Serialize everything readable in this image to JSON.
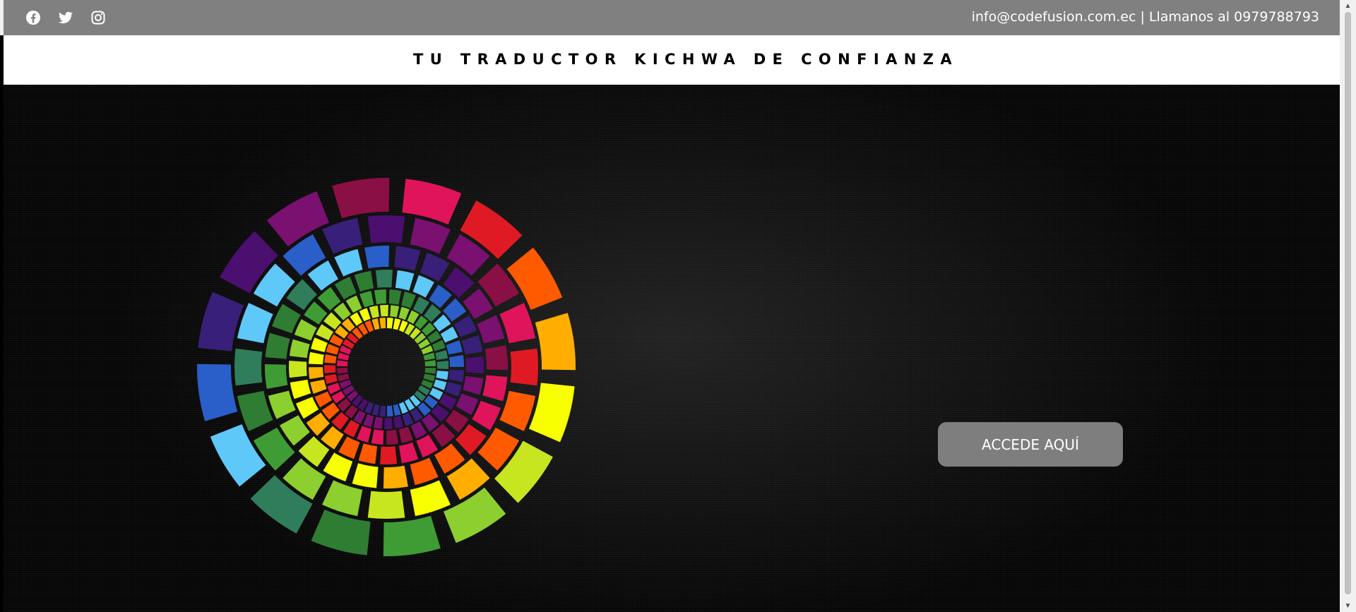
{
  "topbar": {
    "social": [
      "facebook-icon",
      "twitter-icon",
      "instagram-icon"
    ],
    "contact_text": "info@codefusion.com.ec | Llamanos al 0979788793",
    "background": "#808080"
  },
  "brandbar": {
    "tagline": "TU TRADUCTOR KICHWA DE CONFIANZA"
  },
  "hero": {
    "logo_icon": "kichwa-sun-wheel-logo",
    "cta_label": "ACCEDE AQUÍ",
    "cta_color": "#7e7e7e"
  },
  "scrollbar": {
    "up_icon": "chevron-up-icon",
    "down_icon": "chevron-down-icon"
  },
  "colors": {
    "logo_palette": [
      "#f7ff00",
      "#c8e620",
      "#8ccf2e",
      "#3f9c35",
      "#2e7d32",
      "#2f7d5a",
      "#5ec8f8",
      "#2a5fc9",
      "#38207a",
      "#4b0f70",
      "#7a1070",
      "#8a0f45",
      "#e0145a",
      "#e01a24",
      "#ff5a00",
      "#ffae00"
    ]
  }
}
